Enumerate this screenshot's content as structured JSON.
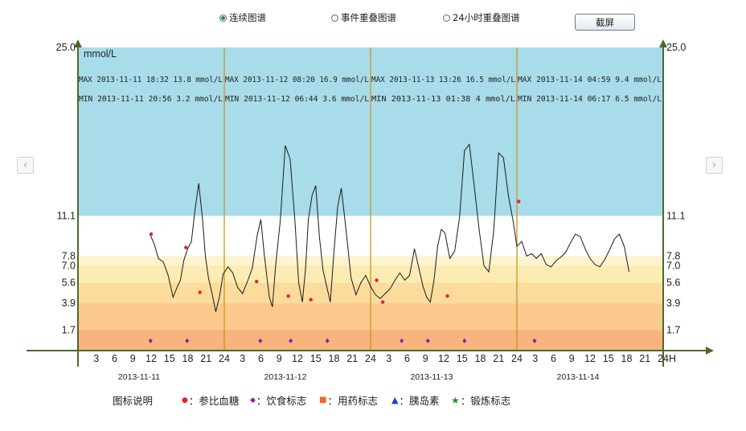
{
  "controls": {
    "view_modes": [
      {
        "label": "连续图谱",
        "selected": true
      },
      {
        "label": "事件重叠图谱",
        "selected": false
      },
      {
        "label": "24小时重叠图谱",
        "selected": false
      }
    ],
    "screenshot_label": "截屏",
    "prev_icon": "chevron-left-icon",
    "next_icon": "chevron-right-icon"
  },
  "legend": {
    "title": "图标说明",
    "items": [
      {
        "symbol": "●",
        "color": "#e8202a",
        "label": "：参比血糖"
      },
      {
        "symbol": "◆",
        "color": "#8a1db5",
        "label": "：饮食标志"
      },
      {
        "symbol": "■",
        "color": "#f26522",
        "label": "：用药标志"
      },
      {
        "symbol": "▲",
        "color": "#1a3fd6",
        "label": "：胰岛素"
      },
      {
        "symbol": "★",
        "color": "#2e8b2e",
        "label": "：锻炼标志"
      }
    ]
  },
  "chart_data": {
    "type": "line",
    "ylabel": "mmol/L",
    "ylim": [
      0,
      25.0
    ],
    "y_ticks": [
      "1.7",
      "3.9",
      "5.6",
      "7.0",
      "7.8",
      "11.1",
      "25.0"
    ],
    "x_unit_label": "H",
    "hour_ticks": [
      "3",
      "6",
      "9",
      "12",
      "15",
      "18",
      "21",
      "24"
    ],
    "days": [
      "2013-11-11",
      "2013-11-12",
      "2013-11-13",
      "2013-11-14"
    ],
    "bands": [
      {
        "from": 11.1,
        "to": 25.0,
        "color": "#a8dcea"
      },
      {
        "from": 7.8,
        "to": 11.1,
        "color": "#ffffff"
      },
      {
        "from": 7.0,
        "to": 7.8,
        "color": "#fdf4d0"
      },
      {
        "from": 5.6,
        "to": 7.0,
        "color": "#fcecb2"
      },
      {
        "from": 3.9,
        "to": 5.6,
        "color": "#fcdc9c"
      },
      {
        "from": 1.7,
        "to": 3.9,
        "color": "#fbc98c"
      },
      {
        "from": 0,
        "to": 1.7,
        "color": "#f8b37e"
      }
    ],
    "day_stats": [
      {
        "max": "MAX 2013-11-11 18:32  13.8 mmol/L",
        "min": "MIN 2013-11-11 20:56  3.2 mmol/L"
      },
      {
        "max": "MAX 2013-11-12 08:20  16.9 mmol/L",
        "min": "MIN 2013-11-12 06:44  3.6 mmol/L"
      },
      {
        "max": "MAX 2013-11-13 13:26  16.5 mmol/L",
        "min": "MIN 2013-11-13 01:38  4 mmol/L"
      },
      {
        "max": "MAX 2013-11-14 04:59  9.4 mmol/L",
        "min": "MIN 2013-11-14 06:17  6.5 mmol/L"
      }
    ],
    "series": [
      {
        "x": [
          11.8,
          12.5,
          13.2,
          14.0,
          14.8,
          15.6,
          16.4,
          16.8,
          17.4,
          18.0,
          18.6,
          19.2,
          19.8,
          20.4,
          20.9,
          21.4,
          22.0,
          22.6,
          23.2,
          23.8,
          24.6,
          25.4,
          26.2,
          27.0,
          27.8,
          28.6,
          29.4,
          30.0,
          30.5,
          31.0,
          31.4,
          31.9,
          32.4,
          33.2,
          34.0,
          34.8,
          35.6,
          36.2,
          36.8,
          37.3,
          37.8,
          38.4,
          39.0,
          39.6,
          40.2,
          40.8,
          41.4,
          42.0,
          42.6,
          43.2,
          44.0,
          44.8,
          45.6,
          46.4,
          47.2,
          48.0,
          48.8,
          49.6,
          50.4,
          51.2,
          52.0,
          52.8,
          53.6,
          54.4,
          55.2,
          56.0,
          56.6,
          57.2,
          57.8,
          58.4,
          59.0,
          59.6,
          60.2,
          61.0,
          61.8,
          62.6,
          63.4,
          64.2,
          65.0,
          65.8,
          66.6,
          67.4,
          68.2,
          69.0,
          69.8,
          70.6,
          71.4,
          72.0,
          72.8,
          73.6,
          74.4,
          75.2,
          76.0,
          76.8,
          77.6,
          78.4,
          79.2,
          80.0,
          80.8,
          81.6,
          82.4,
          83.2,
          84.0,
          84.8,
          85.6,
          86.4,
          87.2,
          88.0,
          88.8,
          89.6,
          90.4
        ],
        "y": [
          9.6,
          8.8,
          7.6,
          7.3,
          6.2,
          4.4,
          5.4,
          5.8,
          7.5,
          8.4,
          9.0,
          11.6,
          13.8,
          11.0,
          7.8,
          6.0,
          4.7,
          3.2,
          4.4,
          6.3,
          6.9,
          6.4,
          5.2,
          4.7,
          5.7,
          6.8,
          9.5,
          10.8,
          8.2,
          6.0,
          4.4,
          3.6,
          6.9,
          10.8,
          16.9,
          15.8,
          10.6,
          5.6,
          4.0,
          6.6,
          10.8,
          12.8,
          13.6,
          9.4,
          6.6,
          5.3,
          4.0,
          8.2,
          11.9,
          13.4,
          9.8,
          6.0,
          4.6,
          5.6,
          6.2,
          5.3,
          4.6,
          4.3,
          4.7,
          5.1,
          5.8,
          6.4,
          5.8,
          6.2,
          8.4,
          6.6,
          5.3,
          4.4,
          4.0,
          5.8,
          8.6,
          10.0,
          9.7,
          7.6,
          8.2,
          11.0,
          16.5,
          17.0,
          13.6,
          10.0,
          7.0,
          6.5,
          9.9,
          16.3,
          15.9,
          12.8,
          10.6,
          8.6,
          9.0,
          7.8,
          8.0,
          7.6,
          8.0,
          7.1,
          6.9,
          7.4,
          7.7,
          8.1,
          8.9,
          9.6,
          9.4,
          8.4,
          7.6,
          7.1,
          6.9,
          7.5,
          8.3,
          9.2,
          9.6,
          8.6,
          6.5
        ]
      }
    ],
    "reference_glucose": {
      "x": [
        12.0,
        17.7,
        20.0,
        29.3,
        34.5,
        38.2,
        49.0,
        50.0,
        60.6,
        72.3
      ],
      "y": [
        9.6,
        8.5,
        4.8,
        5.7,
        4.5,
        4.2,
        5.8,
        4.0,
        4.5,
        12.3
      ]
    },
    "meal_markers_x": [
      11.9,
      17.9,
      29.9,
      34.9,
      40.9,
      53.1,
      57.4,
      63.4,
      74.9
    ],
    "meal_markers_y": 0.8
  }
}
